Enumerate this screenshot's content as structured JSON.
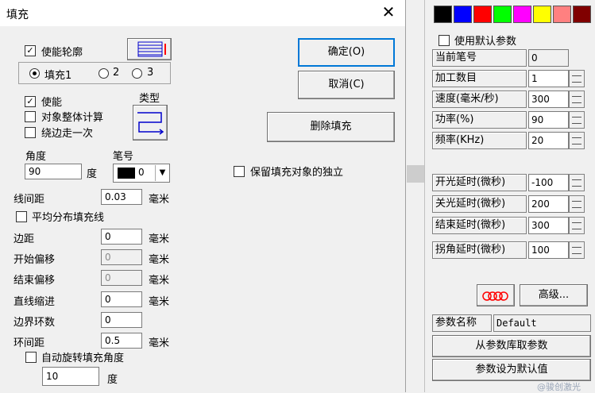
{
  "dialog": {
    "title": "填充",
    "enable_outline": "使能轮廓",
    "fill_tabs": [
      "填充1",
      "2",
      "3"
    ],
    "enable": "使能",
    "whole_object_calc": "对象整体计算",
    "walk_edge_once": "绕边走一次",
    "type_label": "类型",
    "angle_label": "角度",
    "angle_value": "90",
    "angle_unit": "度",
    "pen_label": "笔号",
    "pen_value": "0",
    "line_spacing_label": "线间距",
    "line_spacing_value": "0.03",
    "mm": "毫米",
    "avg_distribute": "平均分布填充线",
    "margin_label": "边距",
    "margin_value": "0",
    "start_offset_label": "开始偏移",
    "start_offset_value": "0",
    "end_offset_label": "结束偏移",
    "end_offset_value": "0",
    "line_indent_label": "直线缩进",
    "line_indent_value": "0",
    "border_loops_label": "边界环数",
    "border_loops_value": "0",
    "loop_spacing_label": "环间距",
    "loop_spacing_value": "0.5",
    "auto_rotate": "自动旋转填充角度",
    "rotate_value": "10",
    "rotate_unit": "度",
    "ok": "确定(O)",
    "cancel": "取消(C)",
    "delete_fill": "删除填充",
    "keep_independent": "保留填充对象的独立"
  },
  "colors": [
    "#000000",
    "#0000ff",
    "#ff0000",
    "#00ff00",
    "#ff00ff",
    "#ffff00",
    "#ff8080",
    "#800000"
  ],
  "panel": {
    "use_default": "使用默认参数",
    "rows": [
      {
        "label": "当前笔号",
        "value": "0"
      },
      {
        "label": "加工数目",
        "value": "1"
      },
      {
        "label": "速度(毫米/秒)",
        "value": "300"
      },
      {
        "label": "功率(%)",
        "value": "90"
      },
      {
        "label": "频率(KHz)",
        "value": "20"
      },
      {
        "label": "开光延时(微秒)",
        "value": "-100"
      },
      {
        "label": "关光延时(微秒)",
        "value": "200"
      },
      {
        "label": "结束延时(微秒)",
        "value": "300"
      },
      {
        "label": "拐角延时(微秒)",
        "value": "100"
      }
    ],
    "advanced": "高级...",
    "param_name_label": "参数名称",
    "param_name_value": "Default",
    "load_from_lib": "从参数库取参数",
    "set_default": "参数设为默认值",
    "watermark": "@骏创激光"
  }
}
